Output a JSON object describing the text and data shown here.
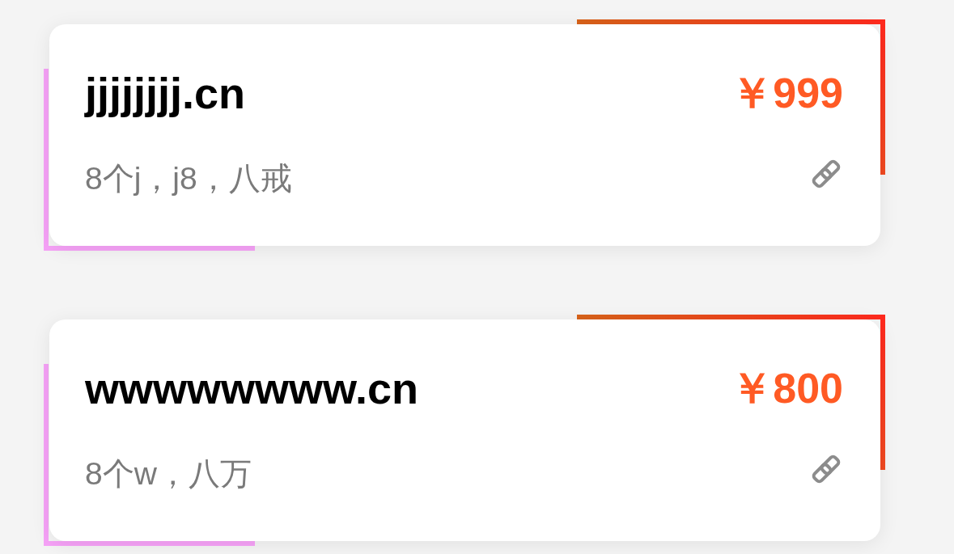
{
  "listings": [
    {
      "domain": "jjjjjjjj.cn",
      "price": "￥999",
      "description": "8个j，j8，八戒"
    },
    {
      "domain": "wwwwwwww.cn",
      "price": "￥800",
      "description": "8个w，八万"
    }
  ]
}
